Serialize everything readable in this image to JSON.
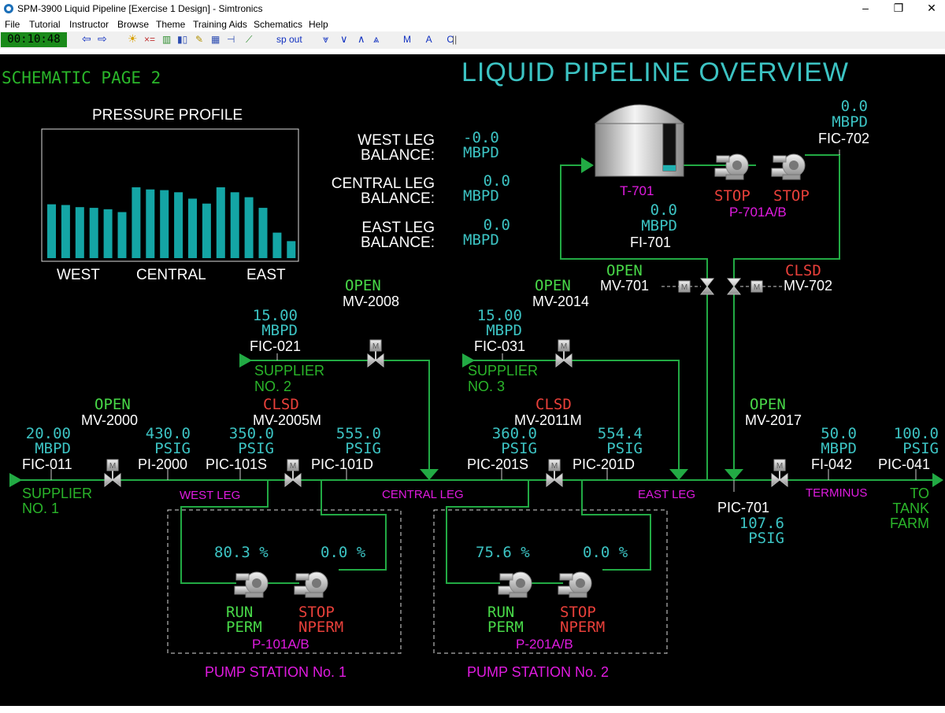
{
  "window": {
    "title": "SPM-3900 Liquid Pipeline [Exercise 1 Design] - Simtronics",
    "minimize": "–",
    "restore": "❐",
    "close": "✕"
  },
  "menu": [
    "File",
    "Tutorial",
    "Instructor",
    "Browse",
    "Theme",
    "Training Aids",
    "Schematics",
    "Help"
  ],
  "toolbar": {
    "clock": "00:10:48",
    "sp_out": "sp out",
    "mac": "M A C"
  },
  "screen": {
    "page_label": "SCHEMATIC PAGE 2",
    "title": "LIQUID PIPELINE OVERVIEW"
  },
  "pressure_profile": {
    "title": "PRESSURE PROFILE",
    "labels": [
      "WEST",
      "CENTRAL",
      "EAST"
    ],
    "bars": [
      0.76,
      0.75,
      0.72,
      0.71,
      0.69,
      0.65,
      1.0,
      0.97,
      0.96,
      0.93,
      0.84,
      0.77,
      1.0,
      0.93,
      0.86,
      0.71,
      0.36,
      0.24
    ]
  },
  "balances": {
    "west": {
      "label1": "WEST LEG",
      "label2": "BALANCE:",
      "value": "-0.0",
      "unit": "MBPD"
    },
    "central": {
      "label1": "CENTRAL LEG",
      "label2": "BALANCE:",
      "value": "0.0",
      "unit": "MBPD"
    },
    "east": {
      "label1": "EAST LEG",
      "label2": "BALANCE:",
      "value": "0.0",
      "unit": "MBPD"
    }
  },
  "tank": {
    "tag": "T-701",
    "level": 0.12
  },
  "p701": {
    "a_status": "STOP",
    "b_status": "STOP",
    "tag": "P-701A/B"
  },
  "fic702": {
    "value": "0.0",
    "unit": "MBPD",
    "tag": "FIC-702"
  },
  "fi701": {
    "value": "0.0",
    "unit": "MBPD",
    "tag": "FI-701"
  },
  "mv701": {
    "status": "OPEN",
    "tag": "MV-701"
  },
  "mv702": {
    "status": "CLSD",
    "tag": "MV-702"
  },
  "mv2008": {
    "status": "OPEN",
    "tag": "MV-2008"
  },
  "mv2014": {
    "status": "OPEN",
    "tag": "MV-2014"
  },
  "fic021": {
    "value": "15.00",
    "unit": "MBPD",
    "tag": "FIC-021"
  },
  "fic031": {
    "value": "15.00",
    "unit": "MBPD",
    "tag": "FIC-031"
  },
  "supplier2": {
    "line1": "SUPPLIER",
    "line2": "NO. 2"
  },
  "supplier3": {
    "line1": "SUPPLIER",
    "line2": "NO. 3"
  },
  "supplier1": {
    "line1": "SUPPLIER",
    "line2": "NO. 1"
  },
  "fic011": {
    "value": "20.00",
    "unit": "MBPD",
    "tag": "FIC-011"
  },
  "mv2000": {
    "status": "OPEN",
    "tag": "MV-2000"
  },
  "pi2000": {
    "value": "430.0",
    "unit": "PSIG",
    "tag": "PI-2000"
  },
  "pic101s": {
    "value": "350.0",
    "unit": "PSIG",
    "tag": "PIC-101S"
  },
  "mv2005m": {
    "status": "CLSD",
    "tag": "MV-2005M"
  },
  "pic101d": {
    "value": "555.0",
    "unit": "PSIG",
    "tag": "PIC-101D"
  },
  "pic201s": {
    "value": "360.0",
    "unit": "PSIG",
    "tag": "PIC-201S"
  },
  "mv2011m": {
    "status": "CLSD",
    "tag": "MV-2011M"
  },
  "pic201d": {
    "value": "554.4",
    "unit": "PSIG",
    "tag": "PIC-201D"
  },
  "mv2017": {
    "status": "OPEN",
    "tag": "MV-2017"
  },
  "fi042": {
    "value": "50.0",
    "unit": "MBPD",
    "tag": "FI-042"
  },
  "pic041": {
    "value": "100.0",
    "unit": "PSIG",
    "tag": "PIC-041"
  },
  "pic701": {
    "tag": "PIC-701",
    "value": "107.6",
    "unit": "PSIG"
  },
  "legs": {
    "west": "WEST LEG",
    "central": "CENTRAL LEG",
    "east": "EAST LEG",
    "terminus": "TERMINUS"
  },
  "tank_farm": {
    "line1": "TO",
    "line2": "TANK",
    "line3": "FARM"
  },
  "station1": {
    "speed_a": "80.3 %",
    "speed_b": "0.0 %",
    "a_status1": "RUN",
    "a_status2": "PERM",
    "b_status1": "STOP",
    "b_status2": "NPERM",
    "tag": "P-101A/B",
    "name": "PUMP STATION No. 1"
  },
  "station2": {
    "speed_a": "75.6 %",
    "speed_b": "0.0 %",
    "a_status1": "RUN",
    "a_status2": "PERM",
    "b_status1": "STOP",
    "b_status2": "NPERM",
    "tag": "P-201A/B",
    "name": "PUMP STATION No. 2"
  },
  "colors": {
    "background": "#000000",
    "pipe": "#22aa44",
    "value": "#3cc3c3",
    "open": "#48d848",
    "closed": "#e8403a",
    "label": "#e01be0",
    "toolbar_clock": "#1a8a1a"
  },
  "icons": {
    "valve": "m-valve-icon",
    "pump": "centrifugal-pump-icon",
    "tank": "storage-tank-icon"
  }
}
